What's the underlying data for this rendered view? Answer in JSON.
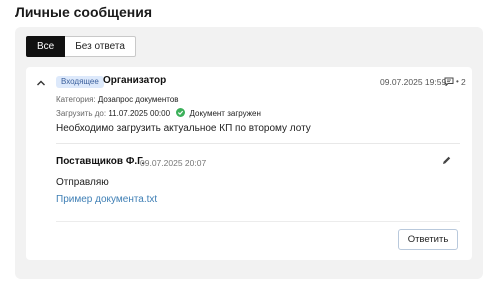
{
  "page": {
    "title": "Личные сообщения"
  },
  "tabs": [
    {
      "label": "Все",
      "active": true
    },
    {
      "label": "Без ответа",
      "active": false
    }
  ],
  "message": {
    "badge": "Входящее",
    "badge_color": "#dde9fb",
    "sender": "Организатор",
    "date": "09.07.2025 19:59",
    "comments_sep": "•",
    "comments_count": "2",
    "category_label": "Категория:",
    "category_value": "Дозапрос документов",
    "upload_label": "Загрузить до:",
    "upload_date": "11.07.2025 00:00",
    "upload_status": "Документ загружен",
    "status_color": "#3cb05a",
    "text": "Необходимо загрузить актуальное КП по второму лоту",
    "icons": [
      "chevron-up-icon",
      "comment-icon",
      "check-circle-icon",
      "pencil-icon"
    ]
  },
  "reply": {
    "author": "Поставщиков Ф.Г.",
    "date": "09.07.2025 20:07",
    "text": "Отправляю",
    "attachment": "Пример документа.txt",
    "link_color": "#3f7fb5"
  },
  "actions": {
    "reply_label": "Ответить"
  }
}
